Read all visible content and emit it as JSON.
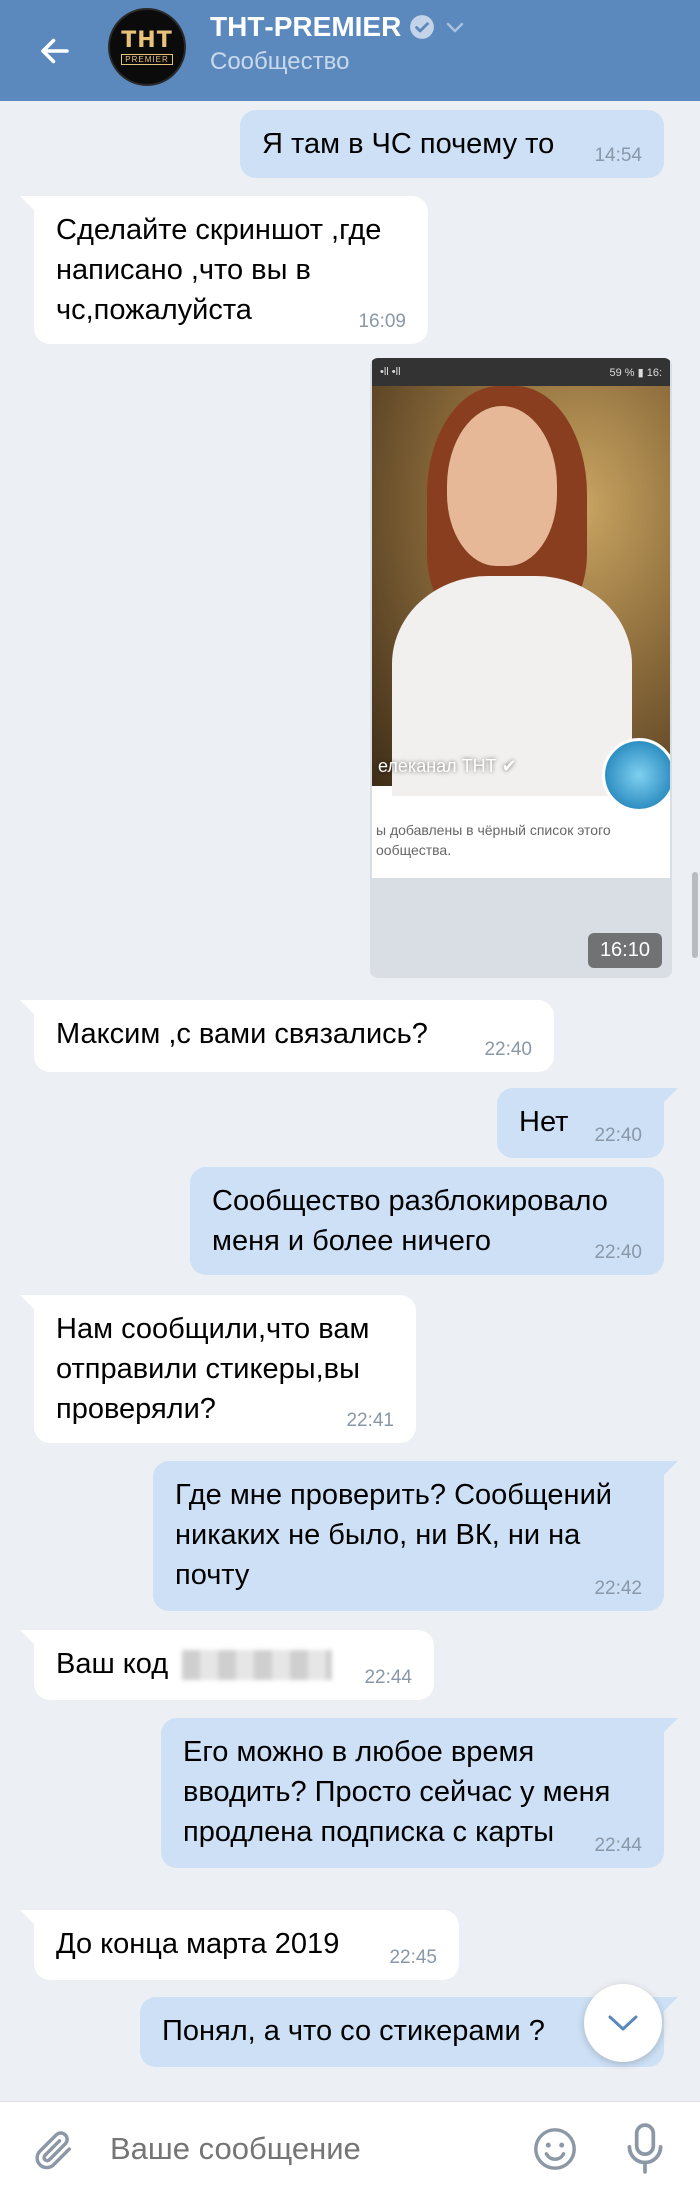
{
  "header": {
    "title": "ТНТ-PREMIER",
    "subtitle": "Сообщество",
    "avatar_logo_top": "ТНТ",
    "avatar_logo_sub": "PREMIER"
  },
  "messages": [
    {
      "dir": "out",
      "text": "Я там в ЧС почему то",
      "time": "14:54"
    },
    {
      "dir": "in",
      "text": "Сделайте скриншот ,где\nнаписано ,что вы в\nчс,пожалуйста",
      "time": "16:09"
    },
    {
      "dir": "out",
      "type": "photo",
      "time": "16:10"
    },
    {
      "dir": "in",
      "text": "Максим ,с вами связались?",
      "time": "22:40"
    },
    {
      "dir": "out",
      "text": "Нет",
      "time": "22:40"
    },
    {
      "dir": "out",
      "text": "Сообщество разблокировало\nменя и более ничего",
      "time": "22:40"
    },
    {
      "dir": "in",
      "text": "Нам сообщили,что вам\nотправили стикеры,вы\nпроверяли?",
      "time": "22:41"
    },
    {
      "dir": "out",
      "text": "Где мне проверить? Сообщений\nникаких не было, ни ВК, ни на\nпочту",
      "time": "22:42"
    },
    {
      "dir": "in",
      "text": "Ваш код",
      "time": "22:44"
    },
    {
      "dir": "out",
      "text": "Его можно в любое время\nвводить? Просто сейчас у меня\nпродлена подписка с карты",
      "time": "22:44"
    },
    {
      "dir": "in",
      "text": "До конца марта 2019",
      "time": "22:45"
    },
    {
      "dir": "out",
      "text": "Понял, а что со стикерами ?",
      "time": ""
    }
  ],
  "photo": {
    "status_left": "•ll •ll",
    "status_right": "59 % ▮ 16:",
    "channel": "елеканал ТНТ ✔",
    "caption": "ы добавлены в чёрный список этого\nообщества."
  },
  "composer": {
    "placeholder": "Ваше сообщение"
  },
  "colors": {
    "header": "#5b88bd",
    "outgoing_bubble": "#cde0f5",
    "incoming_bubble": "#ffffff",
    "background": "#eceff3"
  },
  "icons": [
    "back-arrow-icon",
    "verified-icon",
    "chevron-down-icon",
    "attach-icon",
    "emoji-icon",
    "mic-icon",
    "scroll-down-icon"
  ]
}
